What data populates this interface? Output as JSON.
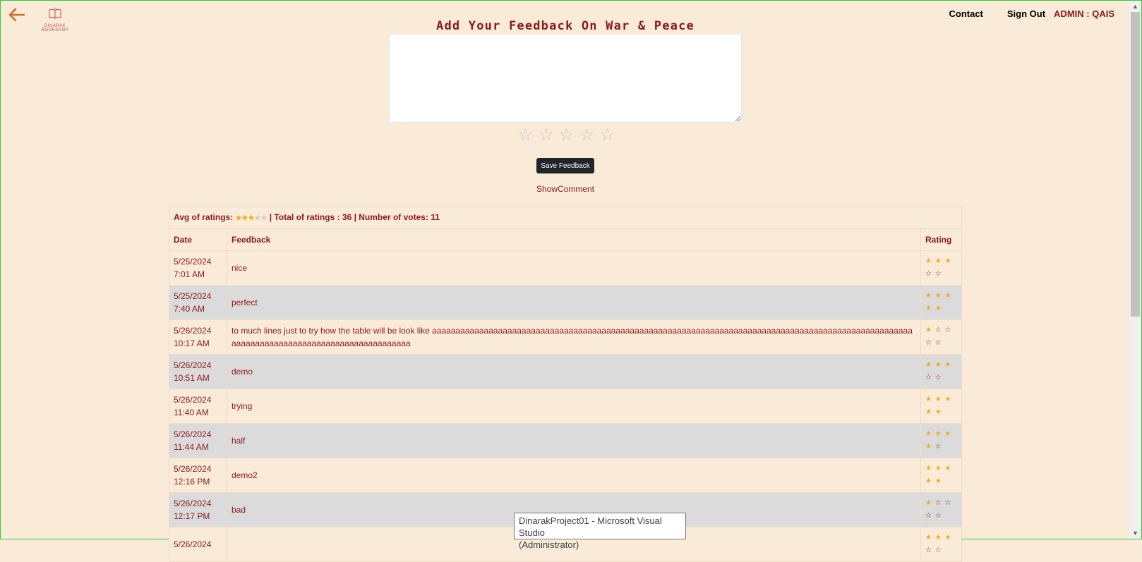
{
  "header": {
    "logo_text": "DINARAK BOOKSHOP",
    "nav": {
      "contact": "Contact",
      "sign_out": "Sign Out",
      "admin": "ADMIN : QAIS"
    }
  },
  "main": {
    "title": "Add Your Feedback On War & Peace",
    "feedback_value": "",
    "save_label": "Save Feedback",
    "show_comment": "ShowComment",
    "input_stars": [
      "☆",
      "☆",
      "☆",
      "☆",
      "☆"
    ]
  },
  "summary": {
    "avg_label": "Avg of ratings:",
    "avg_rating": 3,
    "max_rating": 5,
    "rest": "| Total of ratings : 36 | Number of votes: 11"
  },
  "table": {
    "columns": [
      "Date",
      "Feedback",
      "Rating"
    ],
    "rows": [
      {
        "date": "5/25/2024",
        "time": "7:01 AM",
        "feedback": "nice",
        "rating": 3
      },
      {
        "date": "5/25/2024",
        "time": "7:40 AM",
        "feedback": "perfect",
        "rating": 5
      },
      {
        "date": "5/26/2024",
        "time": "10:17 AM",
        "feedback": "to much lines just to try how the table will be look like aaaaaaaaaaaaaaaaaaaaaaaaaaaaaaaaaaaaaaaaaaaaaaaaaaaaaaaaaaaaaaaaaaaaaaaaaaaaaaaaaaaaaaaaaaaaaaaaaaaaaaaaaaaaaaaaaaaaaaaaaaaaaaaaaaaaaaaaaaaa",
        "rating": 1
      },
      {
        "date": "5/26/2024",
        "time": "10:51 AM",
        "feedback": "demo",
        "rating": 3
      },
      {
        "date": "5/26/2024",
        "time": "11:40 AM",
        "feedback": "trying",
        "rating": 5
      },
      {
        "date": "5/26/2024",
        "time": "11:44 AM",
        "feedback": "half",
        "rating": 4
      },
      {
        "date": "5/26/2024",
        "time": "12:16 PM",
        "feedback": "demo2",
        "rating": 5
      },
      {
        "date": "5/26/2024",
        "time": "12:17 PM",
        "feedback": "bad",
        "rating": 1
      },
      {
        "date": "5/26/2024",
        "time": "",
        "feedback": "",
        "rating": 3
      }
    ]
  },
  "tooltip": {
    "line1": "DinarakProject01 - Microsoft Visual Studio",
    "line2": "(Administrator)"
  },
  "colors": {
    "background": "#f9ebd8",
    "accent": "#8b1a1a",
    "star_on": "#f0ad1c",
    "button": "#212529",
    "row_alt": "#dbdbdb"
  }
}
